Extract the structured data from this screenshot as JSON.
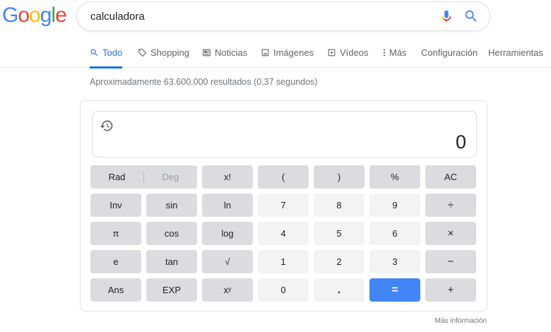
{
  "logo": {
    "letters": [
      {
        "ch": "G",
        "color": "#4285f4"
      },
      {
        "ch": "o",
        "color": "#ea4335"
      },
      {
        "ch": "o",
        "color": "#fbbc05"
      },
      {
        "ch": "g",
        "color": "#4285f4"
      },
      {
        "ch": "l",
        "color": "#34a853"
      },
      {
        "ch": "e",
        "color": "#ea4335"
      }
    ]
  },
  "search": {
    "value": "calculadora",
    "mic_icon": "microphone-icon",
    "search_icon": "search-icon"
  },
  "tabs": [
    {
      "label": "Todo",
      "icon": "search-icon",
      "active": true
    },
    {
      "label": "Shopping",
      "icon": "tag-icon"
    },
    {
      "label": "Noticias",
      "icon": "newspaper-icon"
    },
    {
      "label": "Imágenes",
      "icon": "image-icon"
    },
    {
      "label": "Vídeos",
      "icon": "play-icon"
    },
    {
      "label": "Más",
      "icon": "more-vert-icon"
    },
    {
      "label": "Configuración"
    },
    {
      "label": "Herramientas"
    }
  ],
  "result_stats": "Aproximadamente 63.600.000 resultados (0,37 segundos)",
  "calculator": {
    "display_value": "0",
    "history_icon": "history-icon",
    "rad": "Rad",
    "deg": "Deg",
    "buttons": {
      "fact": "x!",
      "lparen": "(",
      "rparen": ")",
      "percent": "%",
      "ac": "AC",
      "inv": "Inv",
      "sin": "sin",
      "ln": "ln",
      "n7": "7",
      "n8": "8",
      "n9": "9",
      "divide": "÷",
      "pi": "π",
      "cos": "cos",
      "log": "log",
      "n4": "4",
      "n5": "5",
      "n6": "6",
      "multiply": "×",
      "e": "e",
      "tan": "tan",
      "sqrt": "√",
      "n1": "1",
      "n2": "2",
      "n3": "3",
      "minus": "−",
      "ans": "Ans",
      "exp": "EXP",
      "pow": "xʸ",
      "n0": "0",
      "dot": ".",
      "equals": "=",
      "plus": "+"
    },
    "more_info": "Más información"
  },
  "colors": {
    "accent": "#1a73e8",
    "equals": "#4285f4",
    "key_dark": "#dadce0",
    "key_light": "#f1f3f4"
  }
}
